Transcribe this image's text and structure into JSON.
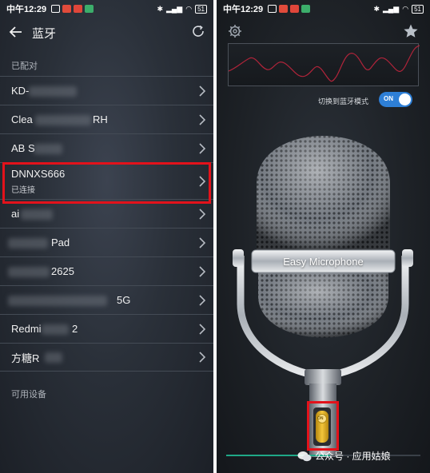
{
  "left_screen": {
    "status": {
      "time": "中午12:29",
      "battery": "51"
    },
    "title": "蓝牙",
    "paired_section_label": "已配对",
    "available_section_label": "可用设备",
    "devices": [
      {
        "name": "KD-",
        "status": ""
      },
      {
        "name": "Clea",
        "name_tail": "RH",
        "status": ""
      },
      {
        "name": "AB S",
        "status": ""
      },
      {
        "name": "DNNXS666",
        "status": "已连接"
      },
      {
        "name": "ai",
        "status": ""
      },
      {
        "name": "Pad",
        "status": ""
      },
      {
        "name": "2625",
        "status": ""
      },
      {
        "name": "5G",
        "status": ""
      },
      {
        "name": "Redmi",
        "name_tail": "2",
        "status": ""
      },
      {
        "name": "方糖R",
        "status": ""
      }
    ]
  },
  "right_screen": {
    "status": {
      "time": "中午12:29",
      "battery": "51"
    },
    "bluetooth_toggle_label": "切换到蓝牙模式",
    "bluetooth_toggle_state": "ON",
    "mic_label": "Easy Microphone",
    "mic_switch_state": "ON",
    "colors": {
      "toggle": "#2e7fd6",
      "highlight": "#e3121b",
      "waveform": "#b0243a",
      "bottom_bar": "#1fa887"
    }
  },
  "watermark": "公众号 · 应用姑娘"
}
